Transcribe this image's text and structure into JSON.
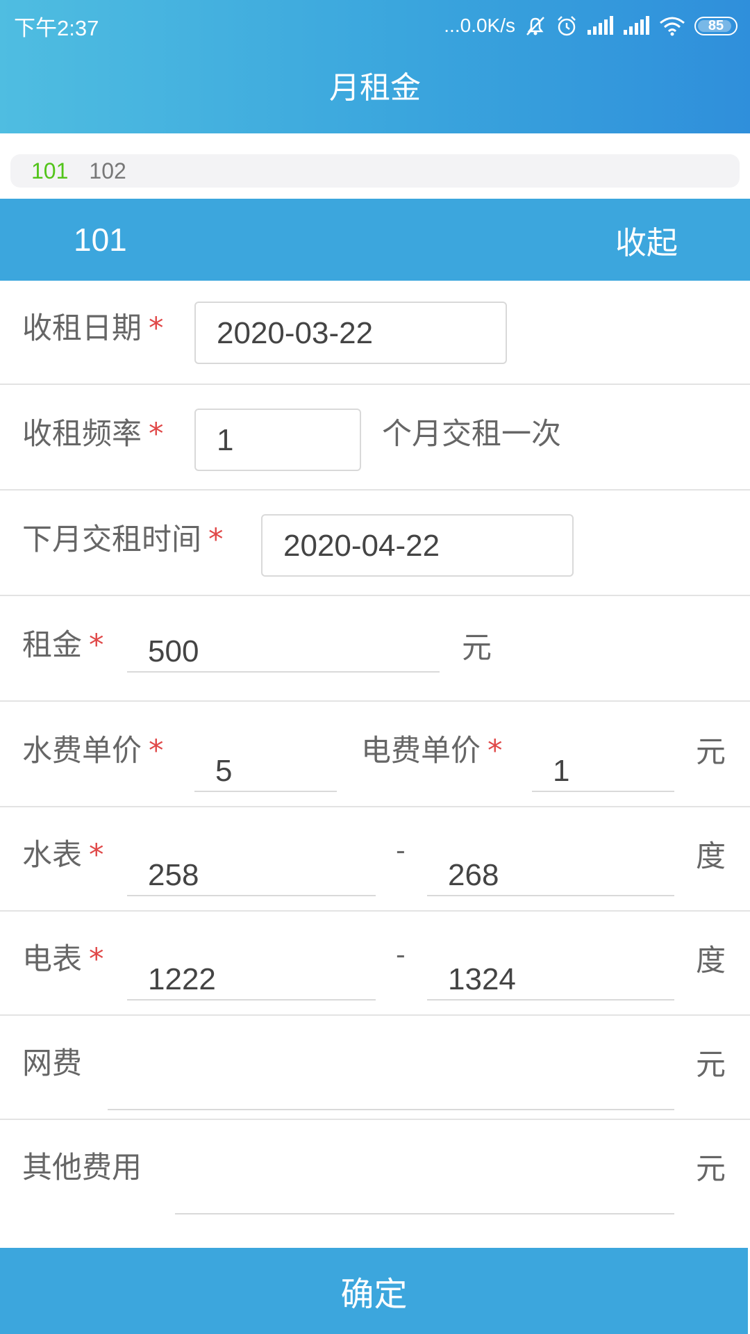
{
  "status_bar": {
    "time": "下午2:37",
    "network_speed": "...0.0K/s",
    "battery": "85"
  },
  "header": {
    "title": "月租金"
  },
  "room_tabs": [
    {
      "label": "101",
      "active": true
    },
    {
      "label": "102",
      "active": false
    }
  ],
  "section": {
    "room": "101",
    "toggle_label": "收起"
  },
  "form": {
    "rent_date": {
      "label": "收租日期",
      "required": "*",
      "value": "2020-03-22"
    },
    "frequency": {
      "label": "收租频率",
      "required": "*",
      "value": "1",
      "suffix": "个月交租一次"
    },
    "next_date": {
      "label": "下月交租时间",
      "required": "*",
      "value": "2020-04-22"
    },
    "rent": {
      "label": "租金",
      "required": "*",
      "value": "500",
      "unit": "元"
    },
    "water_price": {
      "label": "水费单价",
      "required": "*",
      "value": "5"
    },
    "electric_price": {
      "label": "电费单价",
      "required": "*",
      "value": "1",
      "unit": "元"
    },
    "water_meter": {
      "label": "水表",
      "required": "*",
      "from": "258",
      "separator": "-",
      "to": "268",
      "unit": "度"
    },
    "electric_meter": {
      "label": "电表",
      "required": "*",
      "from": "1222",
      "separator": "-",
      "to": "1324",
      "unit": "度"
    },
    "internet_fee": {
      "label": "网费",
      "value": "",
      "unit": "元"
    },
    "other_fees": {
      "label": "其他费用",
      "value": "",
      "unit": "元"
    }
  },
  "confirm_label": "确定",
  "colors": {
    "header_start": "#4fbde1",
    "header_end": "#2f8fdb",
    "accent": "#3ca6dd",
    "tab_active": "#52c41a",
    "required": "#e04848"
  }
}
